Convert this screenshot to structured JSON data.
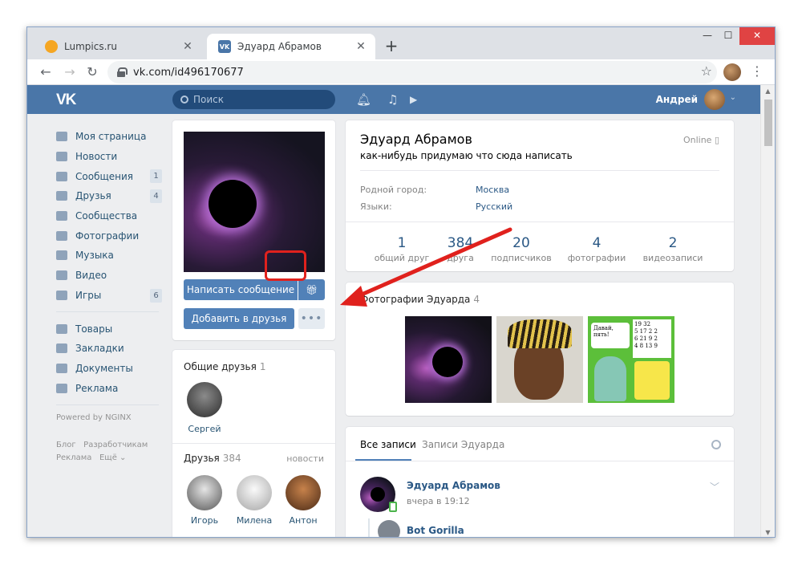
{
  "browser": {
    "tabs": [
      {
        "label": "Lumpics.ru",
        "favicon": "lumpics-favicon"
      },
      {
        "label": "Эдуард Абрамов",
        "favicon": "vk-favicon",
        "active": true
      }
    ],
    "url": "vk.com/id496170677",
    "vk_favicon_text": "VK"
  },
  "vk": {
    "logo": "VK",
    "search_placeholder": "Поиск",
    "user_name": "Андрей",
    "brand_color": "#4a76a8",
    "menu": [
      {
        "label": "Моя страница",
        "icon": "home-icon",
        "count": ""
      },
      {
        "label": "Новости",
        "icon": "news-icon",
        "count": ""
      },
      {
        "label": "Сообщения",
        "icon": "messages-icon",
        "count": "1"
      },
      {
        "label": "Друзья",
        "icon": "friends-icon",
        "count": "4"
      },
      {
        "label": "Сообщества",
        "icon": "groups-icon",
        "count": ""
      },
      {
        "label": "Фотографии",
        "icon": "camera-icon",
        "count": ""
      },
      {
        "label": "Музыка",
        "icon": "music-icon",
        "count": ""
      },
      {
        "label": "Видео",
        "icon": "video-icon",
        "count": ""
      },
      {
        "label": "Игры",
        "icon": "games-icon",
        "count": "6"
      }
    ],
    "menu2": [
      {
        "label": "Товары",
        "icon": "market-icon"
      },
      {
        "label": "Закладки",
        "icon": "star-icon"
      },
      {
        "label": "Документы",
        "icon": "docs-icon"
      },
      {
        "label": "Реклама",
        "icon": "ads-icon"
      }
    ],
    "powered": "Powered by NGINX",
    "footer_links": [
      "Блог",
      "Разработчикам",
      "Реклама",
      "Ещё ⌄"
    ]
  },
  "profile": {
    "name": "Эдуард Абрамов",
    "status": "как-нибудь придумаю что сюда написать",
    "online": "Online",
    "info": [
      {
        "label": "Родной город:",
        "value": "Москва"
      },
      {
        "label": "Языки:",
        "value": "Русский"
      }
    ],
    "stats": [
      {
        "n": "1",
        "l": "общий друг"
      },
      {
        "n": "384",
        "l": "друга"
      },
      {
        "n": "20",
        "l": "подписчиков"
      },
      {
        "n": "4",
        "l": "фотографии"
      },
      {
        "n": "2",
        "l": "видеозаписи"
      }
    ],
    "send_message": "Написать сообщение",
    "add_friend": "Добавить в друзья",
    "more": "•••"
  },
  "common_friends": {
    "title": "Общие друзья",
    "count": "1",
    "items": [
      {
        "name": "Сергей"
      }
    ]
  },
  "friends": {
    "title": "Друзья",
    "count": "384",
    "link": "новости",
    "items": [
      {
        "name": "Игорь"
      },
      {
        "name": "Милена"
      },
      {
        "name": "Антон"
      }
    ]
  },
  "photos": {
    "title": "Фотографии Эдуарда",
    "count": "4",
    "meme_note": "Давай, пять!",
    "meme_board": [
      "19 32",
      "5 17 2 2",
      "6 21 9 2",
      "4 8 13 9"
    ]
  },
  "wall": {
    "tabs": [
      "Все записи",
      "Записи Эдуарда"
    ],
    "post_author": "Эдуард Абрамов",
    "post_time": "вчера в 19:12",
    "repost_author": "Bot Gorilla"
  },
  "annotation_color": "#e0211d"
}
